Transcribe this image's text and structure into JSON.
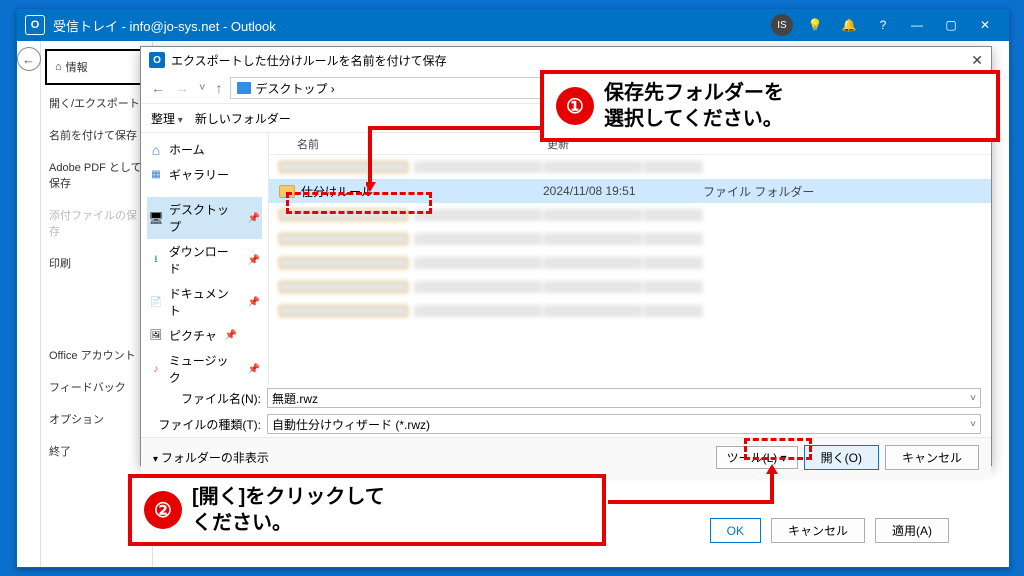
{
  "outlook": {
    "title": "受信トレイ - info@jo-sys.net - Outlook",
    "avatar_initials": "IS",
    "sidebar": [
      "情報",
      "開く/エクスポート",
      "名前を付けて保存",
      "Adobe PDF として保存",
      "添付ファイルの保存",
      "印刷",
      "Office アカウント",
      "フィードバック",
      "オプション",
      "終了"
    ],
    "bottom_buttons": {
      "ok": "OK",
      "cancel": "キャンセル",
      "apply": "適用(A)"
    }
  },
  "dialog": {
    "title": "エクスポートした仕分けルールを名前を付けて保存",
    "breadcrumb": "デスクトップ ›",
    "toolbar": {
      "organize": "整理",
      "newfolder": "新しいフォルダー"
    },
    "columns": {
      "name": "名前",
      "date": "更新",
      "type": ""
    },
    "tree": {
      "home": "ホーム",
      "gallery": "ギャラリー",
      "desktop": "デスクトップ",
      "downloads": "ダウンロード",
      "documents": "ドキュメント",
      "pictures": "ピクチャ",
      "music": "ミュージック"
    },
    "selected_row": {
      "name": "仕分けルール",
      "date": "2024/11/08 19:51",
      "type": "ファイル フォルダー"
    },
    "filename_label": "ファイル名(N):",
    "filename_value": "無題.rwz",
    "filetype_label": "ファイルの種類(T):",
    "filetype_value": "自動仕分けウィザード (*.rwz)",
    "hide_folders": "フォルダーの非表示",
    "tools": "ツール(L)",
    "open": "開く(O)",
    "cancel": "キャンセル"
  },
  "annotations": {
    "c1_num": "①",
    "c1_text": "保存先フォルダーを\n選択してください。",
    "c2_num": "②",
    "c2_text": "[開く]をクリックして\nください。"
  }
}
